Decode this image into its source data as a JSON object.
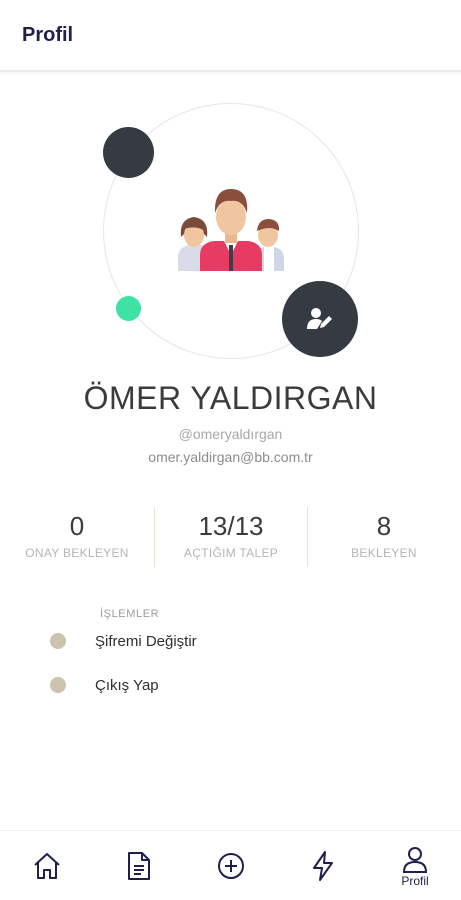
{
  "header": {
    "title": "Profil"
  },
  "profile": {
    "name": "ÖMER YALDIRGAN",
    "handle": "@omeryaldırgan",
    "email": "omer.yaldirgan@bb.com.tr"
  },
  "stats": [
    {
      "value": "0",
      "label": "ONAY BEKLEYEN"
    },
    {
      "value": "13/13",
      "label": "AÇTIĞIM TALEP"
    },
    {
      "value": "8",
      "label": "BEKLEYEN"
    }
  ],
  "actions": {
    "section_label": "İŞLEMLER",
    "items": [
      {
        "label": "Şifremi Değiştir"
      },
      {
        "label": "Çıkış Yap"
      }
    ]
  },
  "nav": {
    "items": [
      {
        "icon": "home-icon",
        "label": ""
      },
      {
        "icon": "document-icon",
        "label": ""
      },
      {
        "icon": "plus-circle-icon",
        "label": ""
      },
      {
        "icon": "lightning-icon",
        "label": ""
      },
      {
        "icon": "person-icon",
        "label": "Profil"
      }
    ]
  },
  "colors": {
    "dark": "#363a42",
    "accent_green": "#3ee2a5",
    "bullet": "#cbc3ad",
    "nav_ink": "#1e1f4a"
  }
}
